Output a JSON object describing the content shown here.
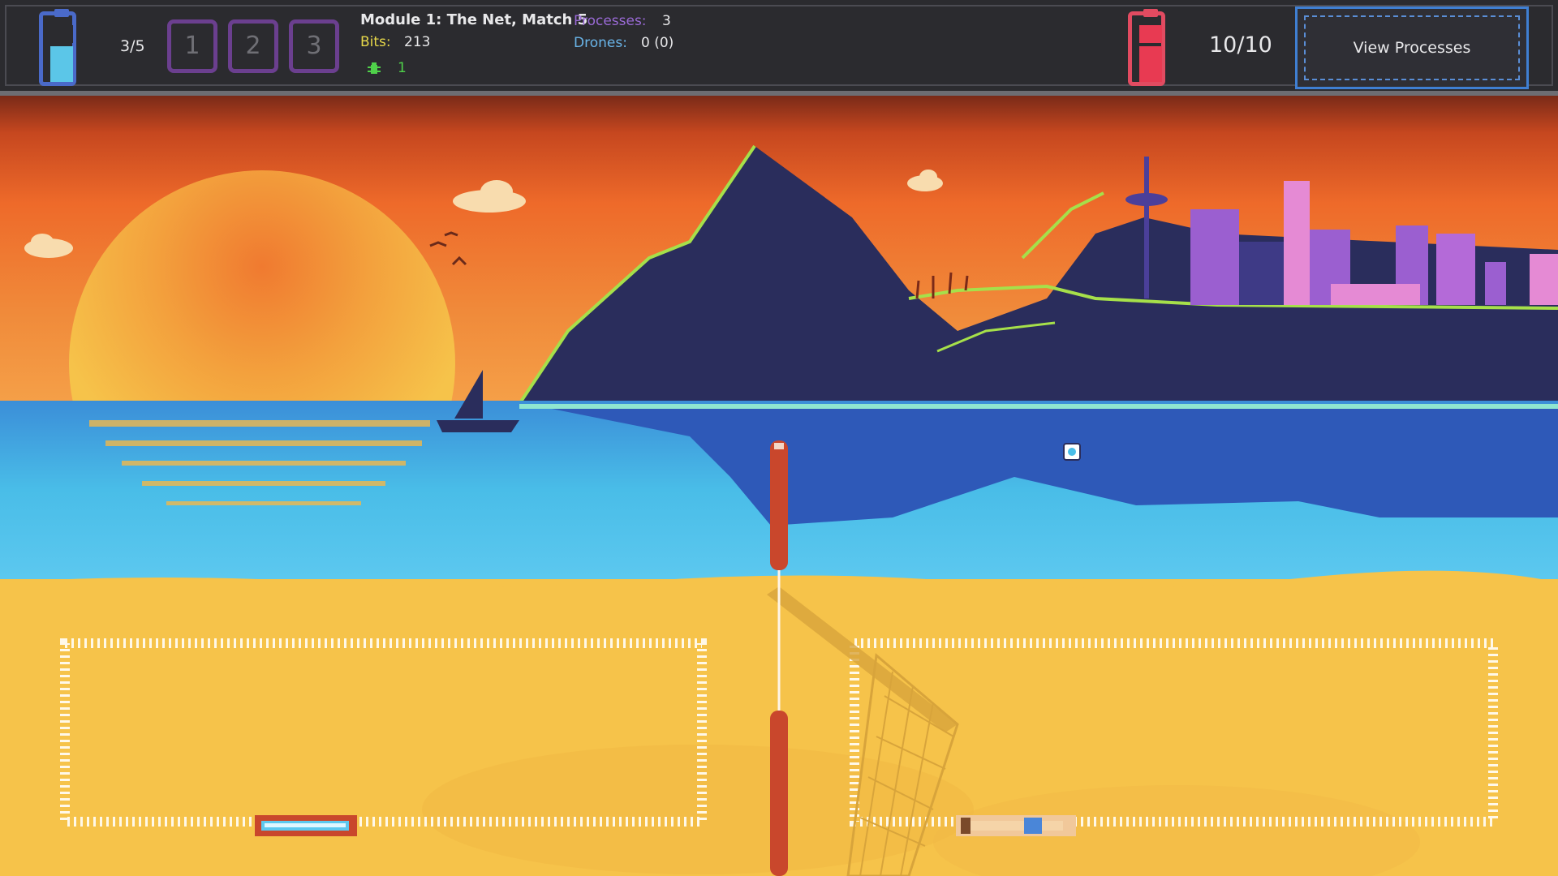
{
  "hud": {
    "player_count": "3/5",
    "slots": [
      "1",
      "2",
      "3"
    ],
    "match_title": "Module 1: The Net, Match 5",
    "bits_label": "Bits:",
    "bits_value": "213",
    "bugs_value": "1",
    "processes_label": "Processes:",
    "processes_value": "3",
    "drones_label": "Drones:",
    "drones_value": "0 (0)",
    "enemy_health": "10/10",
    "view_processes_label": "View Processes"
  },
  "colors": {
    "hud_bg": "#2b2b2f",
    "slot_border": "#6b3f8f",
    "player_battery": "#4a6ac9",
    "enemy_battery": "#e24b61",
    "bits_label": "#e7d84a",
    "processes_label": "#9a6ad6",
    "drones_label": "#69b4e8",
    "bug_icon": "#4fd14a",
    "view_button_border": "#3f7fd2",
    "sky_top": "#a8391b",
    "sky_mid": "#ee6a2a",
    "sun": "#f6c34a",
    "ocean": "#49bde8",
    "ocean_deep": "#2e59b8",
    "sand": "#f6c34a",
    "net_pole": "#c9472c"
  },
  "icons": {
    "player_battery": "battery-icon",
    "enemy_battery": "battery-icon",
    "bug": "bug-icon",
    "ball": "ball-icon",
    "player_paddle": "paddle-icon",
    "enemy_paddle": "paddle-icon"
  }
}
